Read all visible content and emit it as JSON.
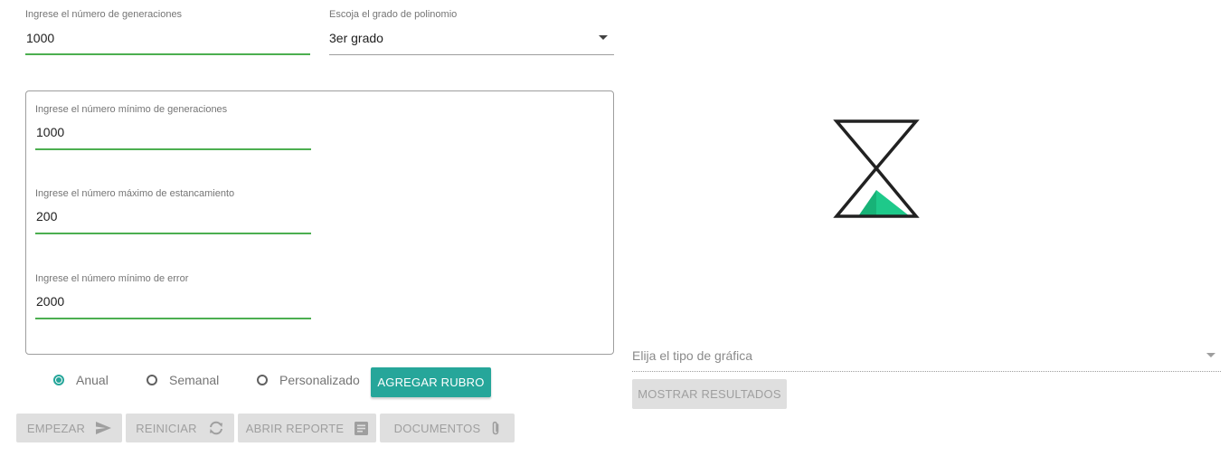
{
  "generations": {
    "label": "Ingrese el número de generaciones",
    "value": "1000"
  },
  "polynomial": {
    "label": "Escoja el grado de polinomio",
    "value": "3er grado"
  },
  "params": {
    "min_generations": {
      "label": "Ingrese el número mínimo de generaciones",
      "value": "1000"
    },
    "max_stagnation": {
      "label": "Ingrese el número máximo de estancamiento",
      "value": "200"
    },
    "min_error": {
      "label": "Ingrese el número mínimo de error",
      "value": "2000"
    }
  },
  "frequency": {
    "options": [
      {
        "label": "Anual",
        "checked": true
      },
      {
        "label": "Semanal",
        "checked": false
      },
      {
        "label": "Personalizado",
        "checked": false
      }
    ]
  },
  "add_item_button": "AGREGAR RUBRO",
  "actions": {
    "start": "EMPEZAR",
    "restart": "REINICIAR",
    "open_report": "ABRIR REPORTE",
    "documents": "DOCUMENTOS"
  },
  "chart_type": {
    "placeholder": "Elija el tipo de gráfica"
  },
  "show_results_button": "MOSTRAR RESULTADOS",
  "colors": {
    "accent": "#26a69a",
    "underline_active": "#4caf50",
    "hourglass_sand": "#1ec98a",
    "disabled_bg": "#dfdfdf"
  },
  "icons": {
    "start": "send-icon",
    "restart": "refresh-icon",
    "open_report": "report-icon",
    "documents": "attachment-icon",
    "loading": "hourglass-icon"
  }
}
